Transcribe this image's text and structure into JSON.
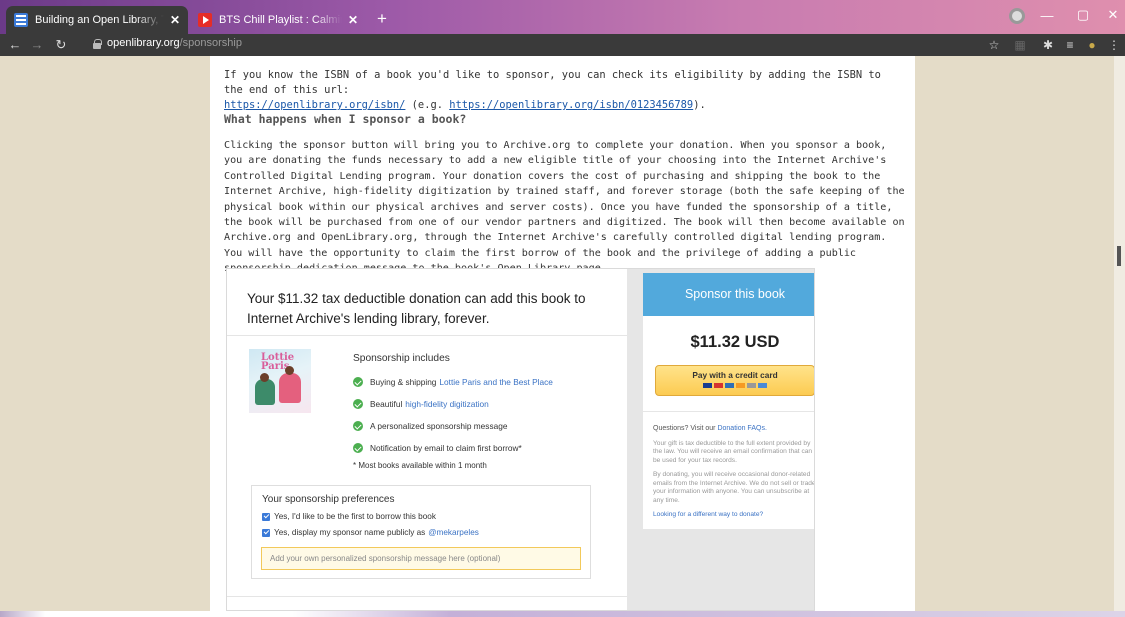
{
  "browser": {
    "tabs": [
      {
        "title": "Building an Open Library, Togeth",
        "active": true
      },
      {
        "title": "BTS Chill Playlist : Calming and Re",
        "active": false
      }
    ],
    "url_host": "openlibrary.org",
    "url_path": "/sponsorship",
    "accent": "#6b3a88"
  },
  "page": {
    "intro_text": "If you know the ISBN of a book you'd like to sponsor, you can check its eligibility by adding the ISBN to the end of this url:",
    "isbn_link": "https://openlibrary.org/isbn/",
    "example_prefix": " (e.g. ",
    "example_link": "https://openlibrary.org/isbn/0123456789",
    "example_suffix": ").",
    "heading": "What happens when I sponsor a book?",
    "paragraph": "Clicking the sponsor button will bring you to Archive.org to complete your donation. When you sponsor a book, you are donating the funds necessary to add a new eligible title of your choosing into the Internet Archive's Controlled Digital Lending program. Your donation covers the cost of purchasing and shipping the book to the Internet Archive, high-fidelity digitization by trained staff, and forever storage (both the safe keeping of the physical book within our physical archives and server costs). Once you have funded the sponsorship of a title, the book will be purchased from one of our vendor partners and digitized. The book will then become available on Archive.org and OpenLibrary.org, through the Internet Archive's carefully controlled digital lending program. You will have the opportunity to claim the first borrow of the book and the privilege of adding a public sponsorship dedication message to the book's Open Library page."
  },
  "widget": {
    "title": "Your $11.32 tax deductible donation can add this book to Internet Archive's lending library, forever.",
    "book_cover_text": "Lottie Paris",
    "includes_heading": "Sponsorship includes",
    "includes": [
      {
        "text": "Buying & shipping",
        "link": "Lottie Paris and the Best Place"
      },
      {
        "text": "Beautiful",
        "link": "high-fidelity digitization"
      },
      {
        "text": "A personalized sponsorship message",
        "link": ""
      },
      {
        "text": "Notification by email to claim first borrow*",
        "link": ""
      }
    ],
    "note": "* Most books available within 1 month",
    "prefs_title": "Your sponsorship preferences",
    "pref_1": "Yes, I'd like to be the first to borrow this book",
    "pref_2": "Yes, display my sponsor name publicly as",
    "pref_2_user": "@mekarpeles",
    "message_placeholder": "Add your own personalized sponsorship message here (optional)",
    "sponsor_button": "Sponsor this book",
    "price": "$11.32 USD",
    "pay_button": "Pay with a credit card",
    "faq_question": "Questions? Visit our",
    "faq_link": "Donation FAQs.",
    "faq_p1": "Your gift is tax deductible to the full extent provided by the law. You will receive an email confirmation that can be used for your tax records.",
    "faq_p2": "By donating, you will receive occasional donor-related emails from the Internet Archive. We do not sell or trade your information with anyone. You can unsubscribe at any time.",
    "faq_alt": "Looking for a different way to donate?",
    "colors": {
      "sponsor_blue": "#52a9dc",
      "pay_yellow": "#fccb52",
      "check_green": "#4caf50",
      "link_blue": "#3a72c4"
    }
  }
}
